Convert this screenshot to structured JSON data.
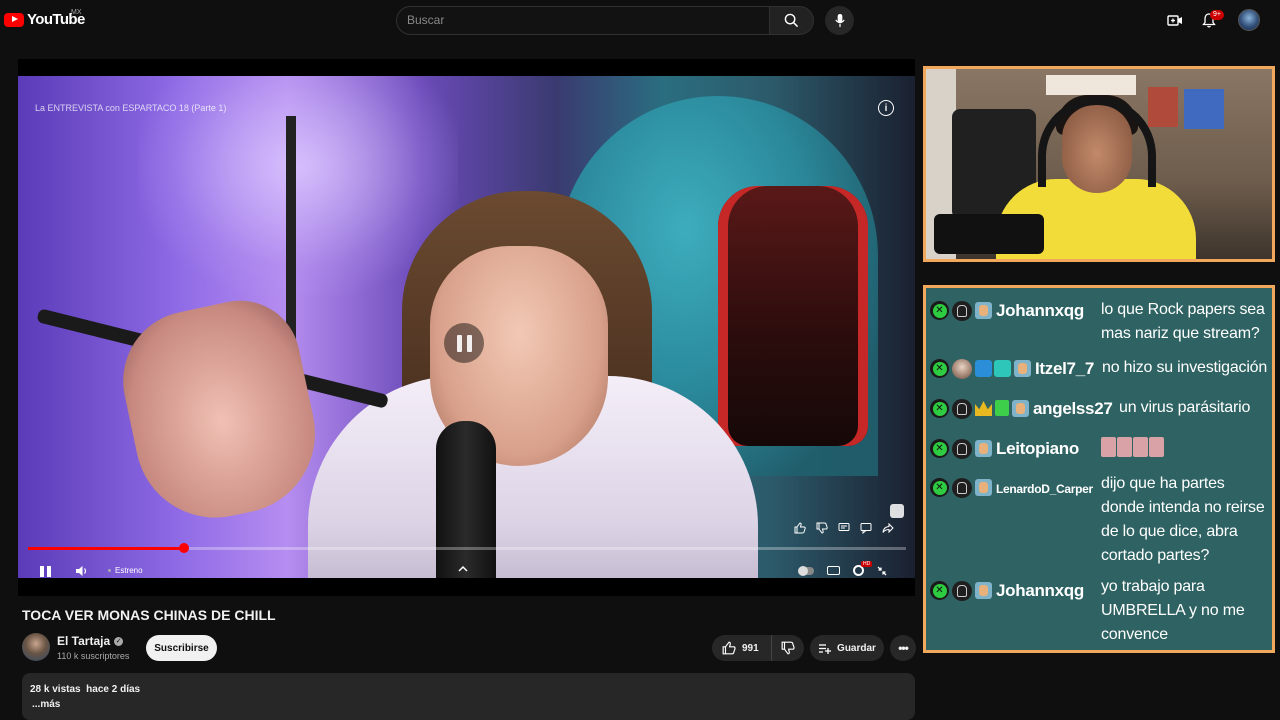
{
  "header": {
    "logo_text": "YouTube",
    "country_code": "MX",
    "search_placeholder": "Buscar",
    "notification_count": "9+"
  },
  "player": {
    "overlay_title": "La ENTREVISTA con ESPARTACO 18 (Parte 1)",
    "live_label": "Estreno",
    "progress_fraction": 0.178,
    "settings_badge": "HD"
  },
  "video": {
    "title": "TOCA VER MONAS CHINAS DE CHILL",
    "channel_name": "El Tartaja",
    "subscribers": "110 k suscriptores",
    "subscribe_label": "Suscribirse",
    "likes": "991",
    "save_label": "Guardar",
    "views": "28 k vistas",
    "date": "hace 2 días",
    "more_label": "...más"
  },
  "chat": {
    "messages": [
      {
        "user": "Johannxqg",
        "line1": "lo que Rock papers sea",
        "line2": "mas nariz que stream?"
      },
      {
        "user": "Itzel7_7",
        "line1": "no hizo su investigación"
      },
      {
        "user": "angelss27",
        "line1": "un virus parásitario"
      },
      {
        "user": "Leitopiano",
        "line1": ""
      },
      {
        "user": "LenardoD_Carper",
        "line1": "dijo que ha partes",
        "line2": "donde intenda no reirse",
        "line3": "de lo que dice, abra",
        "line4": "cortado partes?"
      },
      {
        "user": "Johannxqg",
        "line1": "yo trabajo para",
        "line2": "UMBRELLA y no me",
        "line3": "convence"
      }
    ]
  },
  "colors": {
    "overlay_border": "#f2a85c",
    "chat_background": "#2f6262",
    "progress": "#ff0000",
    "mod_badge": "#2ecc40"
  }
}
